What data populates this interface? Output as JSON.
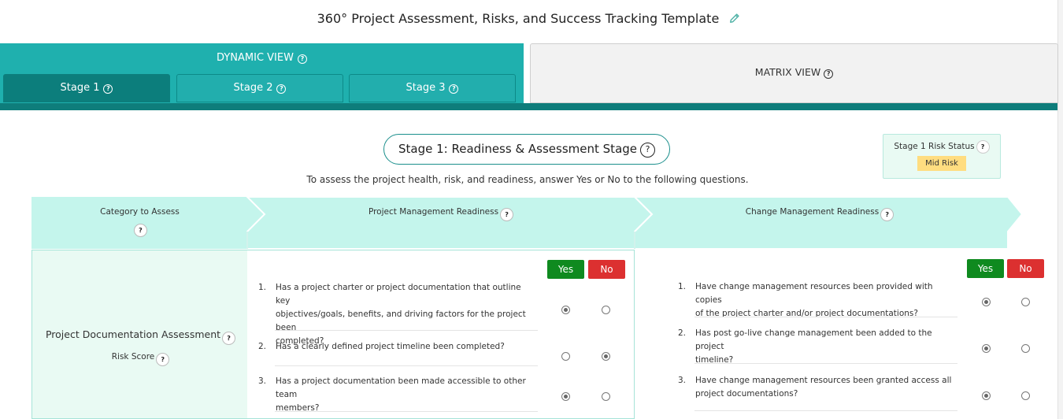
{
  "header": {
    "title": "360° Project Assessment, Risks, and Success Tracking Template",
    "edit_icon": "pencil-icon"
  },
  "tabs": {
    "dynamic_label": "DYNAMIC VIEW",
    "stages": [
      {
        "label": "Stage 1",
        "active": true
      },
      {
        "label": "Stage 2",
        "active": false
      },
      {
        "label": "Stage 3",
        "active": false
      }
    ],
    "matrix_label": "MATRIX VIEW",
    "help_glyph": "?"
  },
  "stage": {
    "title": "Stage 1: Readiness & Assessment Stage",
    "instruction": "To assess the project health, risk, and readiness, answer Yes or No to the following questions."
  },
  "risk_status": {
    "label": "Stage 1 Risk Status",
    "value": "Mid Risk"
  },
  "table": {
    "headers": {
      "category": "Category to Assess",
      "pm": "Project Management Readiness",
      "cm": "Change Management Readiness"
    },
    "yes_label": "Yes",
    "no_label": "No",
    "category": {
      "title": "Project Documentation Assessment",
      "sub": "Risk Score"
    },
    "pm_questions": [
      {
        "num": "1.",
        "lines": [
          "Has a project charter or project documentation that outline key",
          "objectives/goals, benefits, and driving factors for the project been",
          "completed?"
        ],
        "answer": "yes"
      },
      {
        "num": "2.",
        "lines": [
          "Has a clearly defined project timeline been completed?"
        ],
        "answer": "no"
      },
      {
        "num": "3.",
        "lines": [
          "Has a project documentation been made accessible to other team",
          "members?"
        ],
        "answer": "yes"
      }
    ],
    "cm_questions": [
      {
        "num": "1.",
        "lines": [
          "Have change management resources been provided with copies",
          "of the project charter and/or project documentations?"
        ],
        "answer": "yes"
      },
      {
        "num": "2.",
        "lines": [
          "Has post go-live change management been added to the project",
          "timeline?"
        ],
        "answer": "yes"
      },
      {
        "num": "3.",
        "lines": [
          "Have change management resources been granted access all",
          "project documentations?"
        ],
        "answer": "yes"
      }
    ]
  },
  "colors": {
    "teal": "#1fb0ae",
    "teal_dark": "#0c7e7c",
    "header_mint": "#c4f5ec",
    "body_mint": "#e9faf3",
    "yes_green": "#0f8a1f",
    "no_red": "#dc3030",
    "badge_yellow": "#ffdd80"
  }
}
